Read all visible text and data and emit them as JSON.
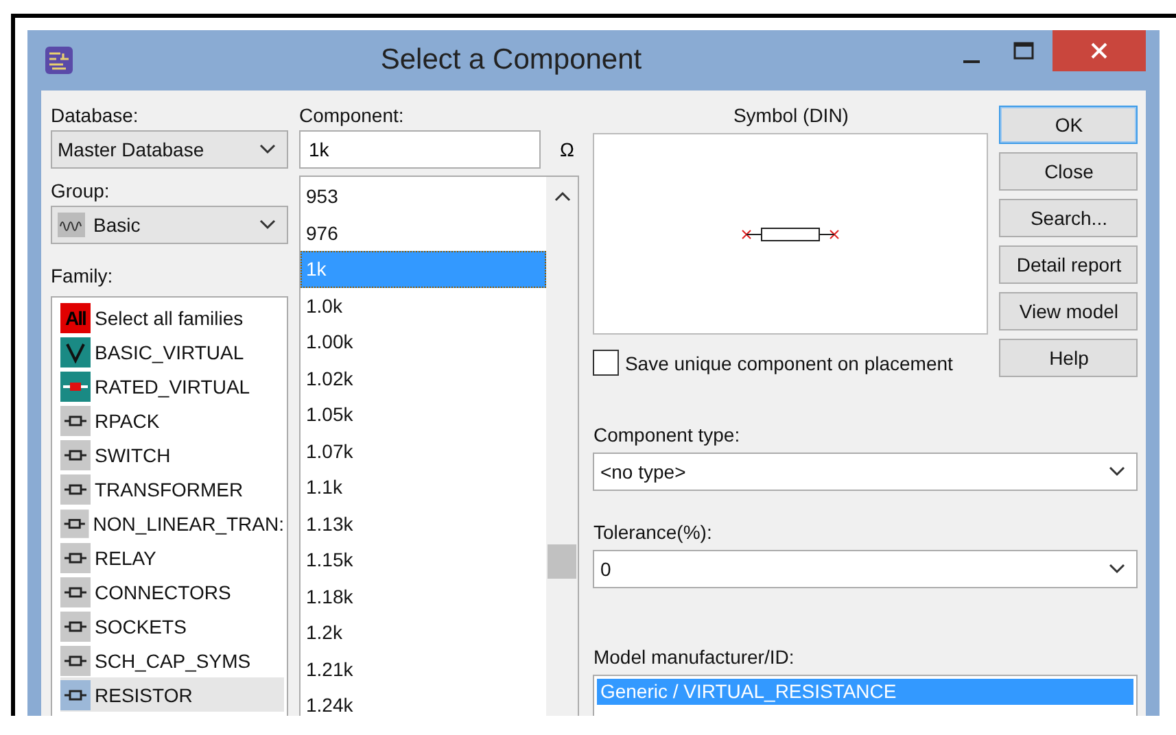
{
  "window": {
    "title": "Select a Component"
  },
  "database": {
    "label": "Database:",
    "value": "Master Database"
  },
  "group": {
    "label": "Group:",
    "value": "Basic"
  },
  "family": {
    "label": "Family:",
    "items": [
      {
        "name": "Select all families",
        "badge": "All",
        "selected": false
      },
      {
        "name": "BASIC_VIRTUAL",
        "selected": false
      },
      {
        "name": "RATED_VIRTUAL",
        "selected": false
      },
      {
        "name": "RPACK",
        "selected": false
      },
      {
        "name": "SWITCH",
        "selected": false
      },
      {
        "name": "TRANSFORMER",
        "selected": false
      },
      {
        "name": "NON_LINEAR_TRAN:",
        "selected": false
      },
      {
        "name": "RELAY",
        "selected": false
      },
      {
        "name": "CONNECTORS",
        "selected": false
      },
      {
        "name": "SOCKETS",
        "selected": false
      },
      {
        "name": "SCH_CAP_SYMS",
        "selected": false
      },
      {
        "name": "RESISTOR",
        "selected": true
      }
    ]
  },
  "component": {
    "label": "Component:",
    "value": "1k",
    "symbol_button": "Ω",
    "items": [
      {
        "text": "953",
        "selected": false
      },
      {
        "text": "976",
        "selected": false
      },
      {
        "text": "1k",
        "selected": true
      },
      {
        "text": "1.0k",
        "selected": false
      },
      {
        "text": "1.00k",
        "selected": false
      },
      {
        "text": "1.02k",
        "selected": false
      },
      {
        "text": "1.05k",
        "selected": false
      },
      {
        "text": "1.07k",
        "selected": false
      },
      {
        "text": "1.1k",
        "selected": false
      },
      {
        "text": "1.13k",
        "selected": false
      },
      {
        "text": "1.15k",
        "selected": false
      },
      {
        "text": "1.18k",
        "selected": false
      },
      {
        "text": "1.2k",
        "selected": false
      },
      {
        "text": "1.21k",
        "selected": false
      },
      {
        "text": "1.24k",
        "selected": false
      }
    ]
  },
  "symbol": {
    "title": "Symbol (DIN)"
  },
  "save_unique": {
    "label": "Save unique component on placement",
    "checked": false
  },
  "buttons": [
    {
      "label": "OK",
      "default": true
    },
    {
      "label": "Close",
      "default": false
    },
    {
      "label": "Search...",
      "default": false
    },
    {
      "label": "Detail report",
      "default": false
    },
    {
      "label": "View model",
      "default": false
    },
    {
      "label": "Help",
      "default": false
    }
  ],
  "component_type": {
    "label": "Component type:",
    "value": "<no type>"
  },
  "tolerance": {
    "label": "Tolerance(%):",
    "value": "0"
  },
  "model": {
    "label": "Model manufacturer/ID:",
    "items": [
      {
        "text": "Generic / VIRTUAL_RESISTANCE",
        "selected": true
      }
    ]
  }
}
